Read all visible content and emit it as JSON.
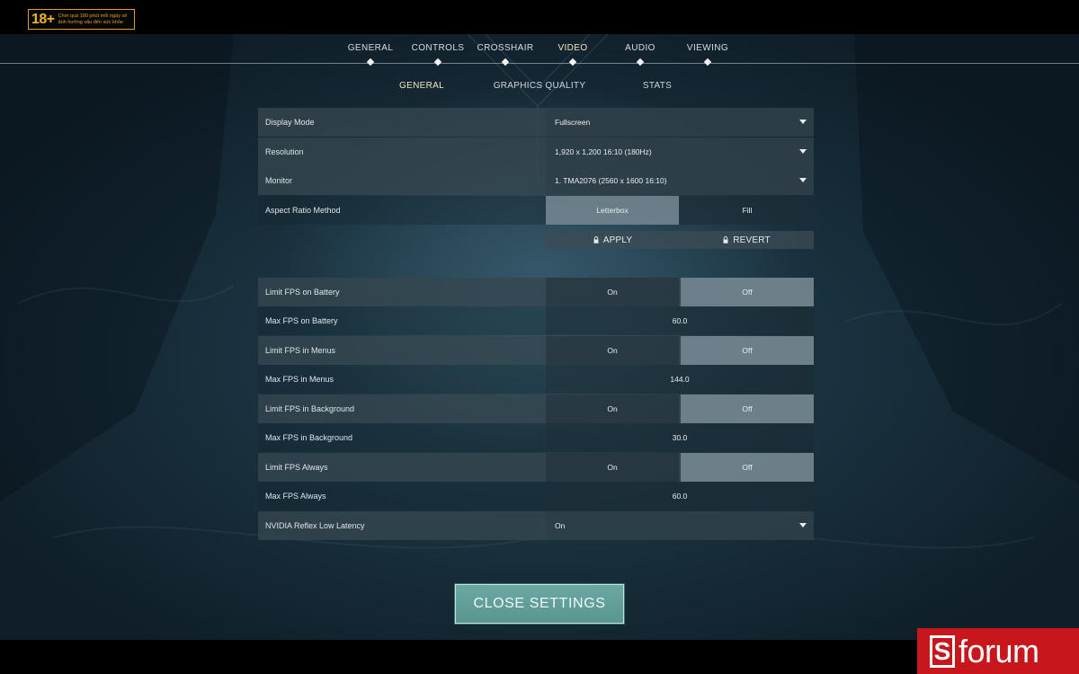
{
  "age_badge": {
    "rating": "18+",
    "text": "Chơi quá 180 phút mỗi ngày sẽ ảnh hưởng xấu đến sức khỏe"
  },
  "nav": {
    "tabs": [
      {
        "label": "GENERAL",
        "active": false
      },
      {
        "label": "CONTROLS",
        "active": false
      },
      {
        "label": "CROSSHAIR",
        "active": false
      },
      {
        "label": "VIDEO",
        "active": true
      },
      {
        "label": "AUDIO",
        "active": false
      },
      {
        "label": "VIEWING",
        "active": false
      }
    ],
    "subtabs": [
      {
        "label": "GENERAL",
        "active": true
      },
      {
        "label": "GRAPHICS QUALITY",
        "active": false
      },
      {
        "label": "STATS",
        "active": false
      }
    ]
  },
  "settings": {
    "display_mode": {
      "label": "Display Mode",
      "value": "Fullscreen"
    },
    "resolution": {
      "label": "Resolution",
      "value": "1,920 x 1,200 16:10 (180Hz)"
    },
    "monitor": {
      "label": "Monitor",
      "value": "1. TMA2076 (2560 x  1600 16:10)"
    },
    "aspect_ratio": {
      "label": "Aspect Ratio Method",
      "options": [
        "Letterbox",
        "Fill"
      ],
      "selected": "Letterbox"
    },
    "apply_label": "APPLY",
    "revert_label": "REVERT",
    "limit_fps_battery": {
      "label": "Limit FPS on Battery",
      "options": [
        "On",
        "Off"
      ],
      "selected": "Off"
    },
    "max_fps_battery": {
      "label": "Max FPS on Battery",
      "value": "60.0"
    },
    "limit_fps_menus": {
      "label": "Limit FPS in Menus",
      "options": [
        "On",
        "Off"
      ],
      "selected": "Off"
    },
    "max_fps_menus": {
      "label": "Max FPS in Menus",
      "value": "144.0"
    },
    "limit_fps_background": {
      "label": "Limit FPS in Background",
      "options": [
        "On",
        "Off"
      ],
      "selected": "Off"
    },
    "max_fps_background": {
      "label": "Max FPS in Background",
      "value": "30.0"
    },
    "limit_fps_always": {
      "label": "Limit FPS Always",
      "options": [
        "On",
        "Off"
      ],
      "selected": "Off"
    },
    "max_fps_always": {
      "label": "Max FPS Always",
      "value": "60.0"
    },
    "nvidia_reflex": {
      "label": "NVIDIA Reflex Low Latency",
      "value": "On"
    }
  },
  "close_button": "CLOSE SETTINGS",
  "watermark": {
    "letter": "S",
    "word": "forum"
  },
  "icons": [
    "chevron-down-icon",
    "lock-icon",
    "diamond-icon"
  ],
  "colors": {
    "accent_active": "#f1e8b8",
    "close_button": "#6aa8a3",
    "watermark": "#c8161d"
  }
}
